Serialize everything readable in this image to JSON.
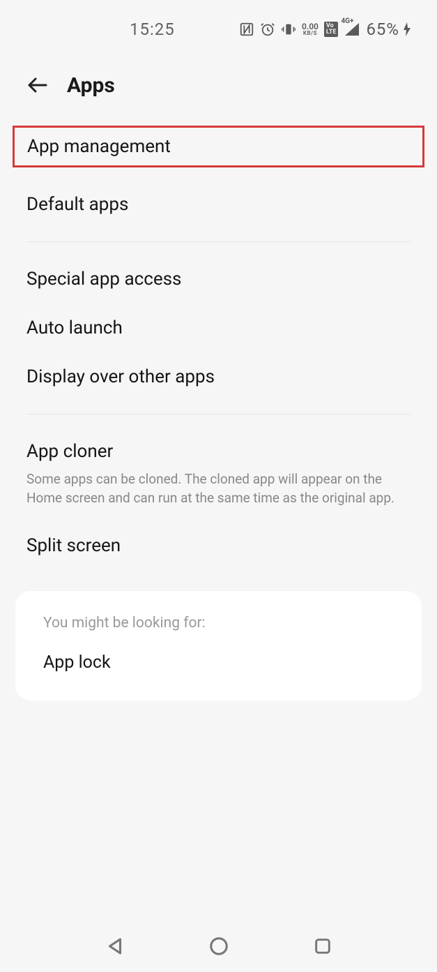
{
  "status": {
    "time": "15:25",
    "data_rate_top": "0.00",
    "data_rate_bot": "KB/S",
    "volte": "Vo\nLTE",
    "net": "4G+",
    "battery_pct": "65%"
  },
  "header": {
    "title": "Apps"
  },
  "rows": {
    "app_management": "App management",
    "default_apps": "Default apps",
    "special_app_access": "Special app access",
    "auto_launch": "Auto launch",
    "display_over": "Display over other apps",
    "app_cloner": "App cloner",
    "app_cloner_desc": "Some apps can be cloned. The cloned app will appear on the Home screen and can run at the same time as the original app.",
    "split_screen": "Split screen"
  },
  "card": {
    "hint": "You might be looking for:",
    "item": "App lock"
  }
}
